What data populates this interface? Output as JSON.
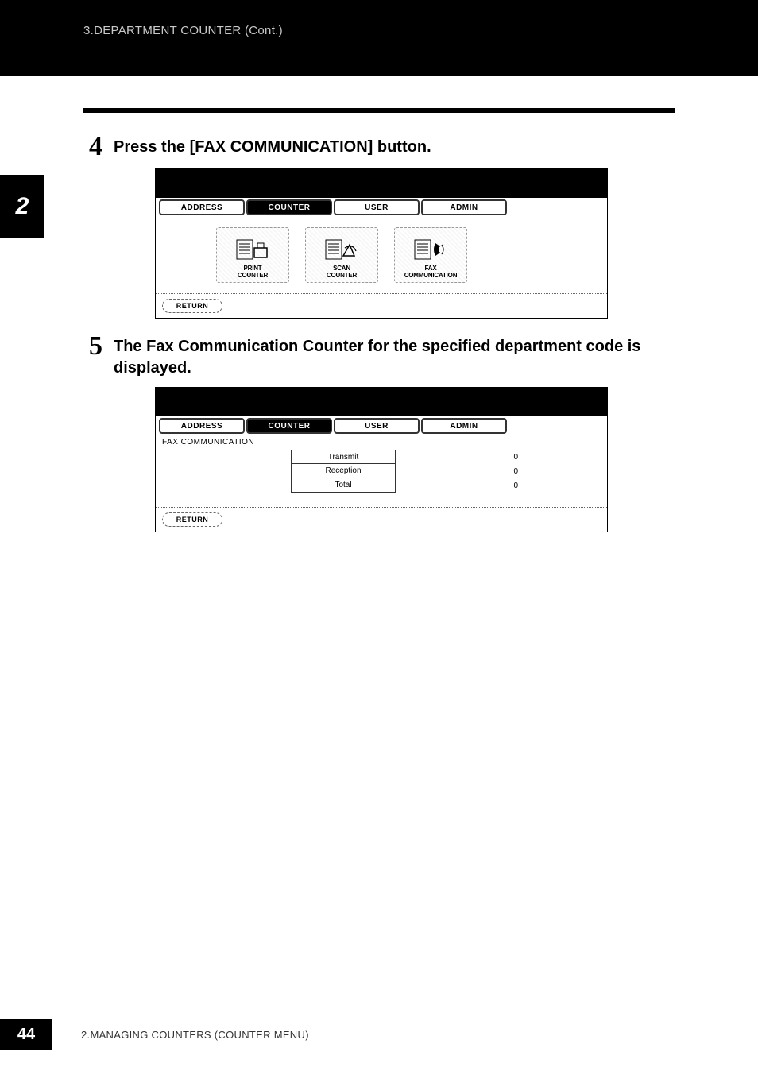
{
  "header": {
    "breadcrumb": "3.DEPARTMENT COUNTER (Cont.)"
  },
  "sidebar": {
    "chapter": "2"
  },
  "steps": [
    {
      "num": "4",
      "text": "Press the [FAX COMMUNICATION] button."
    },
    {
      "num": "5",
      "text": "The Fax Communication Counter for the specified department code is displayed."
    }
  ],
  "screenshot1": {
    "tabs": [
      "ADDRESS",
      "COUNTER",
      "USER",
      "ADMIN"
    ],
    "active_tab_index": 1,
    "icons": [
      {
        "name": "print-counter-icon",
        "label": "PRINT\nCOUNTER"
      },
      {
        "name": "scan-counter-icon",
        "label": "SCAN\nCOUNTER"
      },
      {
        "name": "fax-communication-icon",
        "label": "FAX\nCOMMUNICATION"
      }
    ],
    "return_label": "RETURN"
  },
  "screenshot2": {
    "tabs": [
      "ADDRESS",
      "COUNTER",
      "USER",
      "ADMIN"
    ],
    "active_tab_index": 1,
    "title": "FAX COMMUNICATION",
    "rows": [
      {
        "label": "Transmit",
        "value": "0"
      },
      {
        "label": "Reception",
        "value": "0"
      },
      {
        "label": "Total",
        "value": "0"
      }
    ],
    "return_label": "RETURN"
  },
  "footer": {
    "page_number": "44",
    "text": "2.MANAGING COUNTERS (COUNTER MENU)"
  }
}
